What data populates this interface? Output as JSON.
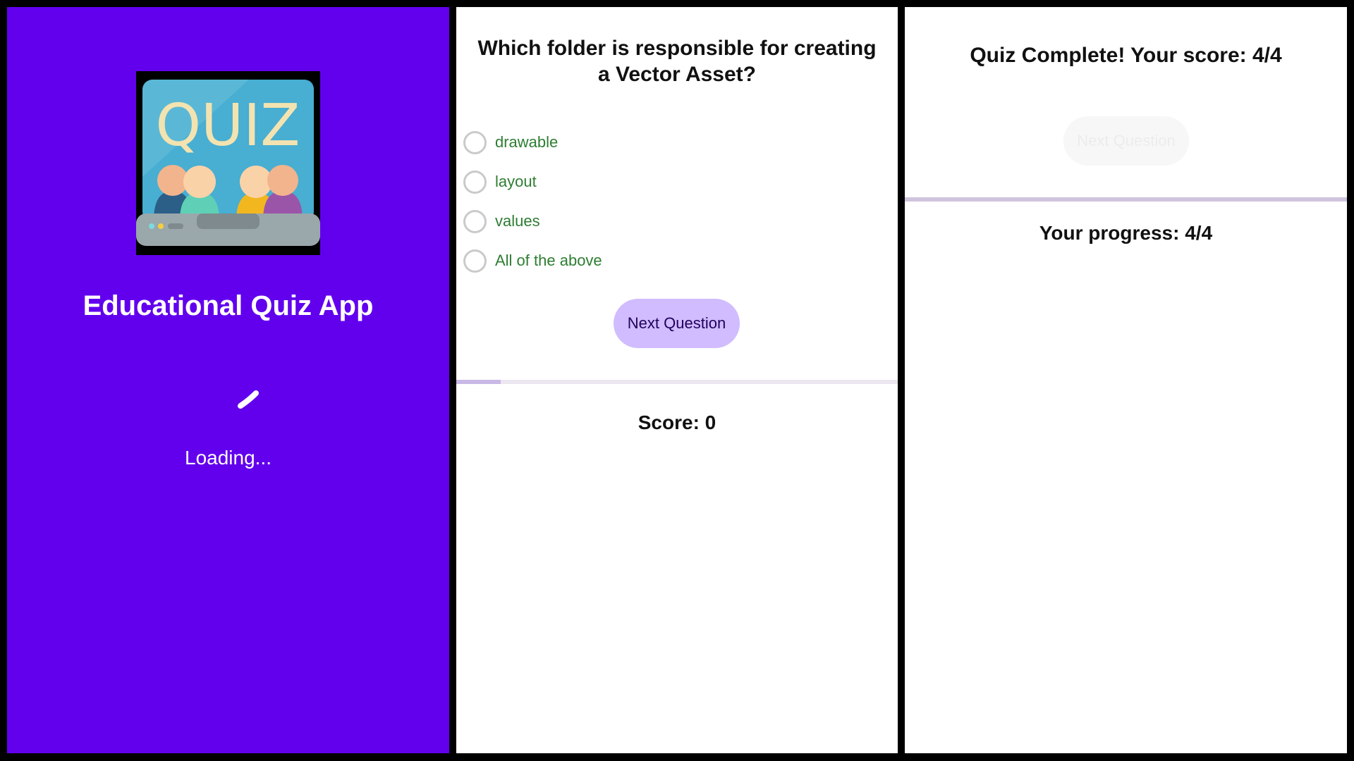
{
  "splash": {
    "app_title": "Educational Quiz App",
    "logo_text": "QUIZ",
    "loading_text": "Loading...",
    "background_color": "#6200EE"
  },
  "question_screen": {
    "question": "Which folder is responsible for creating a Vector Asset?",
    "options": [
      {
        "label": "drawable"
      },
      {
        "label": "layout"
      },
      {
        "label": "values"
      },
      {
        "label": "All of the above"
      }
    ],
    "next_button": "Next Question",
    "progress": 0.1,
    "score_text": "Score: 0"
  },
  "complete_screen": {
    "title": "Quiz Complete! Your score: 4/4",
    "next_button": "Next Question",
    "next_button_enabled": false,
    "progress": 1.0,
    "progress_text": "Your progress: 4/4"
  },
  "colors": {
    "accent": "#6200EE",
    "button": "#D0BCFF",
    "option_text": "#2e7d32"
  }
}
